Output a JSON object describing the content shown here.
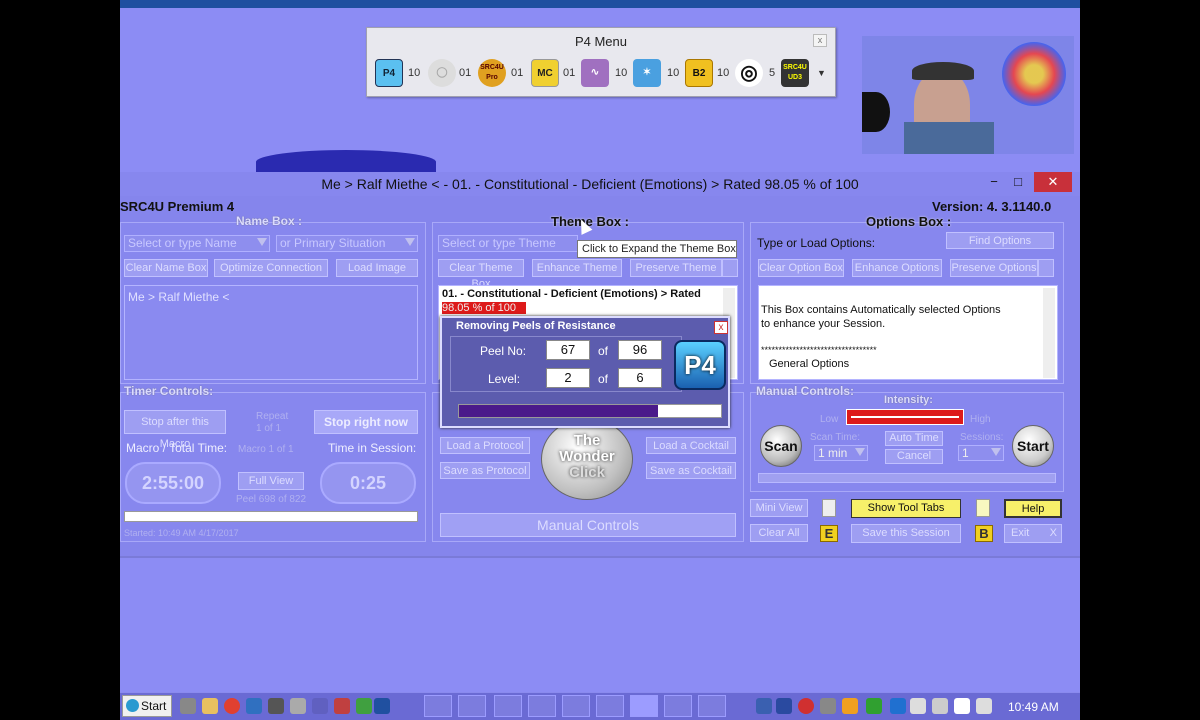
{
  "p4menu": {
    "title": "P4 Menu",
    "close": "x",
    "items": [
      {
        "label": "P4",
        "count": "10"
      },
      {
        "label": "",
        "count": "01"
      },
      {
        "label": "SRC4U Pro",
        "count": "01"
      },
      {
        "label": "MC",
        "count": "01"
      },
      {
        "label": "",
        "count": "10"
      },
      {
        "label": "",
        "count": "10"
      },
      {
        "label": "B2",
        "count": "10"
      },
      {
        "label": "",
        "count": "5"
      },
      {
        "label": "SRC4U UD3",
        "count": ""
      }
    ]
  },
  "window": {
    "title": "Me > Ralf Miethe < - 01. - Constitutional - Deficient (Emotions) > Rated  98.05 % of 100",
    "app_name": "SRC4U Premium 4",
    "version": "Version: 4. 3.1140.0",
    "minimize": "−",
    "maximize": "□",
    "close": "✕"
  },
  "name_box": {
    "header": "Name Box :",
    "select_name_placeholder": "Select or type Name",
    "primary_situation_placeholder": "or Primary Situation",
    "clear_label": "Clear Name Box",
    "optimize_label": "Optimize Connection",
    "load_image_label": "Load Image",
    "text": "Me > Ralf Miethe <"
  },
  "theme_box": {
    "header": "Theme Box :",
    "select_placeholder": "Select or type Theme",
    "clear_label": "Clear Theme Box",
    "enhance_label": "Enhance Theme",
    "preserve_label": "Preserve Theme",
    "text_line1": "01. - Constitutional - Deficient (Emotions) > Rated",
    "text_line2": "98.05 % of  100",
    "tooltip": "Click to Expand the Theme Box"
  },
  "options_box": {
    "header": "Options Box :",
    "type_load_label": "Type or Load Options:",
    "find_label": "Find Options",
    "clear_label": "Clear Option Box",
    "enhance_label": "Enhance Options",
    "preserve_label": "Preserve Options",
    "text_line1": "This Box contains Automatically selected Options",
    "text_line2": "to enhance your Session.",
    "stars": "*********************************",
    "general": "General Options"
  },
  "popup": {
    "title": "Removing Peels of Resistance",
    "close": "x",
    "peel_label": "Peel No:",
    "peel_value": "67",
    "of1": "of",
    "peel_total": "96",
    "level_label": "Level:",
    "level_value": "2",
    "of2": "of",
    "level_total": "6",
    "progress": 0.76,
    "logo": "P4"
  },
  "timer": {
    "header": "Timer Controls:",
    "stop_after_label": "Stop after this Macro",
    "repeat_label": "Repeat",
    "repeat_value": "1 of 1",
    "stop_now_label": "Stop right now",
    "macro_total_label": "Macro / Total Time:",
    "macro_count": "Macro 1 of 1",
    "time_session_label": "Time in Session:",
    "macro_time": "2:55:00",
    "full_view_label": "Full View",
    "peel_info": "Peel 698 of 822",
    "session_time": "0:25",
    "started": "Started: 10:49 AM 4/17/2017"
  },
  "center": {
    "load_protocol": "Load a Protocol",
    "save_protocol": "Save as Protocol",
    "load_cocktail": "Load a Cocktail",
    "save_cocktail": "Save as Cocktail",
    "wonder_line1": "The",
    "wonder_line2": "Wonder",
    "wonder_line3": "Click",
    "manual_controls": "Manual Controls"
  },
  "manual": {
    "header": "Manual Controls:",
    "intensity_label": "Intensity:",
    "low": "Low",
    "high": "High",
    "scan_label": "Scan",
    "start_label": "Start",
    "scan_time_label": "Scan Time:",
    "scan_time_value": "1 min",
    "auto_time_label": "Auto Time",
    "cancel_label": "Cancel",
    "sessions_label": "Sessions:",
    "sessions_value": "1"
  },
  "bottom": {
    "mini_view": "Mini View",
    "show_tool_tabs": "Show Tool Tabs",
    "help": "Help",
    "clear_all": "Clear All",
    "e_label": "E",
    "save_session": "Save this Session",
    "b_label": "B",
    "exit": "Exit",
    "exit_x": "X"
  },
  "taskbar": {
    "start": "Start",
    "clock": "10:49 AM"
  },
  "colors": {
    "desktop": "#8c8cf4",
    "window": "#8787ee",
    "popup": "#5c5cae",
    "progress": "#4a1a8a",
    "accent_red": "#dd1a1a",
    "help_yellow": "#f7f06a"
  }
}
